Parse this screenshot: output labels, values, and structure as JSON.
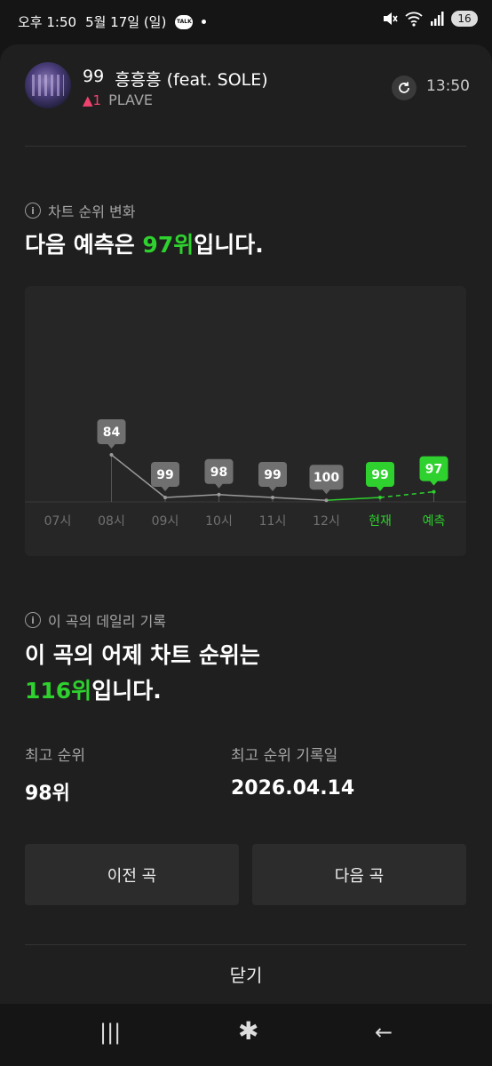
{
  "status_bar": {
    "time": "오후 1:50",
    "date": "5월 17일 (일)",
    "talk_badge": "TALK",
    "battery": "16"
  },
  "song": {
    "rank": "99",
    "title": "흥흥흥 (feat. SOLE)",
    "change": "▲1",
    "artist": "PLAVE",
    "update_time": "13:50"
  },
  "chart_section": {
    "caption": "차트 순위 변화",
    "headline_pre": "다음 예측은 ",
    "headline_rank": "97위",
    "headline_post": "입니다."
  },
  "chart_data": {
    "type": "line",
    "categories": [
      "07시",
      "08시",
      "09시",
      "10시",
      "11시",
      "12시",
      "현재",
      "예측"
    ],
    "series": [
      {
        "values": [
          null,
          84,
          99,
          98,
          99,
          100,
          99,
          97
        ]
      }
    ],
    "highlight_categories": [
      "현재",
      "예측"
    ],
    "y_inverted": true,
    "accent_color": "#2ed12e",
    "label_color": "#707070"
  },
  "daily_section": {
    "caption": "이 곡의 데일리 기록",
    "headline_line1": "이 곡의 어제 차트 순위는",
    "headline_rank": "116위",
    "headline_post": "입니다.",
    "best_rank_label": "최고 순위",
    "best_rank_value": "98위",
    "best_date_label": "최고 순위 기록일",
    "best_date_value": "2026.04.14"
  },
  "buttons": {
    "prev": "이전 곡",
    "next": "다음 곡",
    "close": "닫기"
  },
  "colors": {
    "background": "#1f1f1f",
    "accent_green": "#2ed12e",
    "up_red": "#f0426e"
  }
}
